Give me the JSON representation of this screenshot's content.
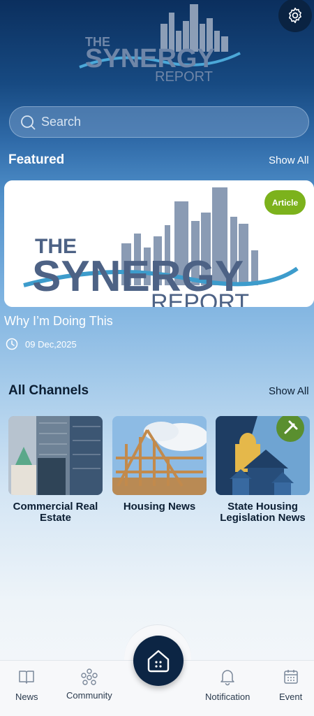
{
  "header": {
    "logo_text_line1": "THE",
    "logo_text_line2": "SYNERGY",
    "logo_text_line3": "REPORT",
    "settings_icon": "gear-icon"
  },
  "search": {
    "placeholder": "Search"
  },
  "featured": {
    "title": "Featured",
    "show_all": "Show All",
    "card": {
      "badge": "Article",
      "headline": "Why I’m Doing This",
      "date": "09 Dec,2025",
      "image_text_line1": "THE",
      "image_text_line2": "SYNERGY",
      "image_text_line3": "REPORT"
    }
  },
  "channels": {
    "title": "All Channels",
    "show_all": "Show All",
    "items": [
      {
        "label": "Commercial Real Estate"
      },
      {
        "label": "Housing News"
      },
      {
        "label": "State Housing Legislation News"
      }
    ]
  },
  "nav": {
    "items": [
      {
        "label": "News",
        "icon": "book-icon"
      },
      {
        "label": "Community",
        "icon": "community-icon"
      },
      {
        "label": "Notification",
        "icon": "bell-icon"
      },
      {
        "label": "Event",
        "icon": "calendar-icon"
      }
    ],
    "home_icon": "home-icon"
  },
  "colors": {
    "badge": "#7cb21c",
    "nav_center": "#0c2544",
    "header_dark": "#0b2f5e"
  }
}
